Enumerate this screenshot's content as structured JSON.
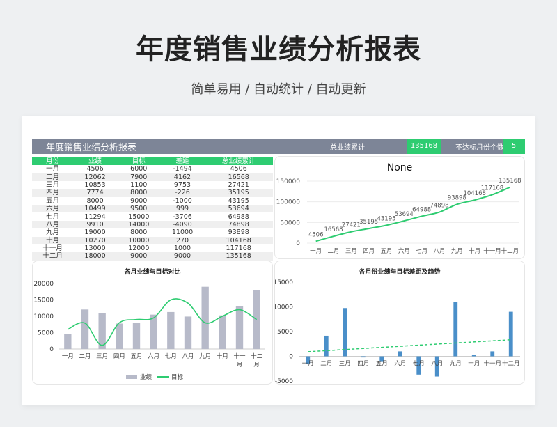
{
  "page": {
    "title": "年度销售业绩分析报表",
    "subtitle": "简单易用 / 自动统计 / 自动更新"
  },
  "header": {
    "title": "年度销售业绩分析报表",
    "total_label": "总业绩累计",
    "total_value": "135168",
    "miss_label": "不达标月份个数",
    "miss_value": "5"
  },
  "table": {
    "columns": [
      "月份",
      "业绩",
      "目标",
      "差距",
      "总业绩累计"
    ],
    "rows": [
      [
        "一月",
        "4506",
        "6000",
        "-1494",
        "4506"
      ],
      [
        "二月",
        "12062",
        "7900",
        "4162",
        "16568"
      ],
      [
        "三月",
        "10853",
        "1100",
        "9753",
        "27421"
      ],
      [
        "四月",
        "7774",
        "8000",
        "-226",
        "35195"
      ],
      [
        "五月",
        "8000",
        "9000",
        "-1000",
        "43195"
      ],
      [
        "六月",
        "10499",
        "9500",
        "999",
        "53694"
      ],
      [
        "七月",
        "11294",
        "15000",
        "-3706",
        "64988"
      ],
      [
        "八月",
        "9910",
        "14000",
        "-4090",
        "74898"
      ],
      [
        "九月",
        "19000",
        "8000",
        "11000",
        "93898"
      ],
      [
        "十月",
        "10270",
        "10000",
        "270",
        "104168"
      ],
      [
        "十一月",
        "13000",
        "12000",
        "1000",
        "117168"
      ],
      [
        "十二月",
        "18000",
        "9000",
        "9000",
        "135168"
      ]
    ]
  },
  "colors": {
    "green": "#2ecc71",
    "gray_bar": "#b7bac9",
    "blue_bar": "#4a8fc9",
    "header": "#7d8597"
  },
  "chart_data": [
    {
      "type": "line",
      "title": "None",
      "categories": [
        "一月",
        "二月",
        "三月",
        "四月",
        "五月",
        "六月",
        "七月",
        "八月",
        "九月",
        "十月",
        "十一月",
        "十二月"
      ],
      "values": [
        4506,
        16568,
        27421,
        35195,
        43195,
        53694,
        64988,
        74898,
        93898,
        104168,
        117168,
        135168
      ],
      "yticks": [
        0,
        50000,
        100000,
        150000
      ],
      "ylim": [
        0,
        150000
      ],
      "grid": true
    },
    {
      "type": "bar",
      "title": "各月业绩与目标对比",
      "categories": [
        "一月",
        "二月",
        "三月",
        "四月",
        "五月",
        "六月",
        "七月",
        "八月",
        "九月",
        "十月",
        "十一月",
        "十二月"
      ],
      "series": [
        {
          "name": "业绩",
          "type": "bar",
          "values": [
            4506,
            12062,
            10853,
            7774,
            8000,
            10499,
            11294,
            9910,
            19000,
            10270,
            13000,
            18000
          ]
        },
        {
          "name": "目标",
          "type": "line",
          "values": [
            6000,
            7900,
            1100,
            8000,
            9000,
            9500,
            15000,
            14000,
            8000,
            10000,
            12000,
            9000
          ]
        }
      ],
      "yticks": [
        0,
        5000,
        10000,
        15000,
        20000
      ],
      "ylim": [
        0,
        20000
      ],
      "legend": "bottom"
    },
    {
      "type": "bar",
      "title": "各月份业绩与目标差距及趋势",
      "categories": [
        "一月",
        "二月",
        "三月",
        "四月",
        "五月",
        "六月",
        "七月",
        "八月",
        "九月",
        "十月",
        "十一月",
        "十二月"
      ],
      "values": [
        -1494,
        4162,
        9753,
        -226,
        -1000,
        999,
        -3706,
        -4090,
        11000,
        270,
        1000,
        9000
      ],
      "trendline": "linear",
      "yticks": [
        -5000,
        0,
        5000,
        10000,
        15000
      ],
      "ylim": [
        -5000,
        15000
      ]
    }
  ]
}
